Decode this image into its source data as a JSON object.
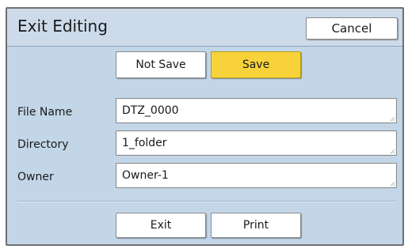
{
  "dialog": {
    "title": "Exit Editing",
    "cancel_label": "Cancel"
  },
  "save_options": {
    "not_save_label": "Not Save",
    "save_label": "Save",
    "selected": "Save"
  },
  "fields": {
    "file_name": {
      "label": "File Name",
      "value": "DTZ_0000"
    },
    "directory": {
      "label": "Directory",
      "value": "1_folder"
    },
    "owner": {
      "label": "Owner",
      "value": "Owner-1"
    }
  },
  "actions": {
    "exit_label": "Exit",
    "print_label": "Print"
  },
  "colors": {
    "dialog_background": "#c2d6e8",
    "selected_button": "#f7d23a"
  }
}
